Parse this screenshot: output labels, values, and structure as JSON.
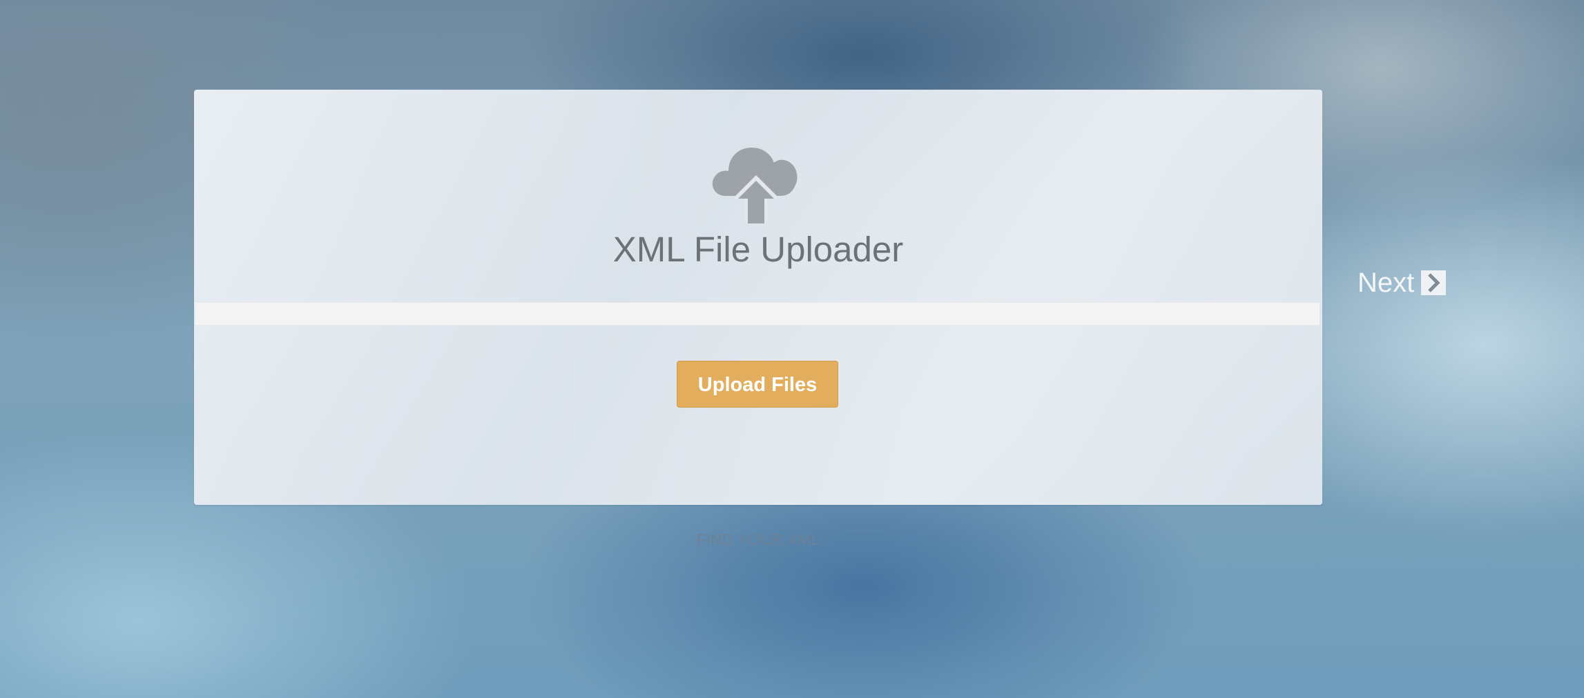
{
  "uploader": {
    "title": "XML File Uploader",
    "upload_button_label": "Upload Files",
    "hint": "FIND YOUR XML",
    "icon": "cloud-upload-icon"
  },
  "nav": {
    "next_label": "Next",
    "next_icon": "chevron-right-icon"
  },
  "colors": {
    "upload_button": "#e2ae5e",
    "title_text": "#6b7379",
    "icon": "#9ea3a7"
  }
}
